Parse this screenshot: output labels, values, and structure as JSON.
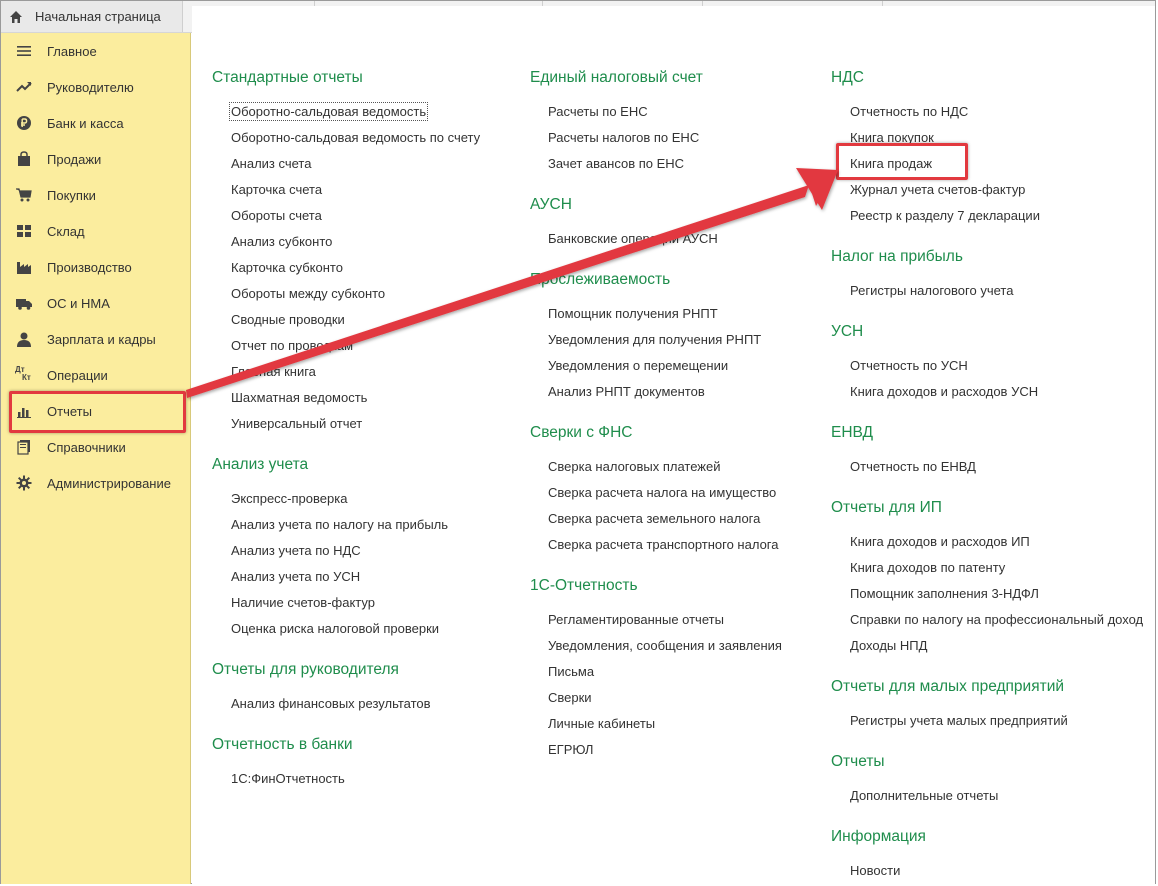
{
  "topbar": {
    "home_label": "Начальная страница"
  },
  "sidebar": {
    "items": [
      {
        "label": "Главное",
        "icon": "menu-icon"
      },
      {
        "label": "Руководителю",
        "icon": "trend-icon"
      },
      {
        "label": "Банк и касса",
        "icon": "ruble-icon"
      },
      {
        "label": "Продажи",
        "icon": "bag-icon"
      },
      {
        "label": "Покупки",
        "icon": "cart-icon"
      },
      {
        "label": "Склад",
        "icon": "grid-icon"
      },
      {
        "label": "Производство",
        "icon": "factory-icon"
      },
      {
        "label": "ОС и НМА",
        "icon": "truck-icon"
      },
      {
        "label": "Зарплата и кадры",
        "icon": "person-icon"
      },
      {
        "label": "Операции",
        "icon": "dt-kt-icon",
        "icon_text_top": "Дт",
        "icon_text_bottom": "Кт"
      },
      {
        "label": "Отчеты",
        "icon": "bar-chart-icon"
      },
      {
        "label": "Справочники",
        "icon": "books-icon"
      },
      {
        "label": "Администрирование",
        "icon": "gear-icon"
      }
    ]
  },
  "columns": {
    "col1": [
      {
        "title": "Стандартные отчеты",
        "links": [
          "Оборотно-сальдовая ведомость",
          "Оборотно-сальдовая ведомость по счету",
          "Анализ счета",
          "Карточка счета",
          "Обороты счета",
          "Анализ субконто",
          "Карточка субконто",
          "Обороты между субконто",
          "Сводные проводки",
          "Отчет по проводкам",
          "Главная книга",
          "Шахматная ведомость",
          "Универсальный отчет"
        ]
      },
      {
        "title": "Анализ учета",
        "links": [
          "Экспресс-проверка",
          "Анализ учета по налогу на прибыль",
          "Анализ учета по НДС",
          "Анализ учета по УСН",
          "Наличие счетов-фактур",
          "Оценка риска налоговой проверки"
        ]
      },
      {
        "title": "Отчеты для руководителя",
        "links": [
          "Анализ финансовых результатов"
        ]
      },
      {
        "title": "Отчетность в банки",
        "links": [
          "1С:ФинОтчетность"
        ]
      }
    ],
    "col2": [
      {
        "title": "Единый налоговый счет",
        "links": [
          "Расчеты по ЕНС",
          "Расчеты налогов по ЕНС",
          "Зачет авансов по ЕНС"
        ]
      },
      {
        "title": "АУСН",
        "links": [
          "Банковские операции АУСН"
        ]
      },
      {
        "title": "Прослеживаемость",
        "links": [
          "Помощник получения РНПТ",
          "Уведомления для получения РНПТ",
          "Уведомления о перемещении",
          "Анализ РНПТ документов"
        ]
      },
      {
        "title": "Сверки с ФНС",
        "links": [
          "Сверка налоговых платежей",
          "Сверка расчета налога на имущество",
          "Сверка расчета земельного налога",
          "Сверка расчета транспортного налога"
        ]
      },
      {
        "title": "1С-Отчетность",
        "links": [
          "Регламентированные отчеты",
          "Уведомления, сообщения и заявления",
          "Письма",
          "Сверки",
          "Личные кабинеты",
          "ЕГРЮЛ"
        ]
      }
    ],
    "col3": [
      {
        "title": "НДС",
        "links": [
          "Отчетность по НДС",
          "Книга покупок",
          "Книга продаж",
          "Журнал учета счетов-фактур",
          "Реестр к разделу 7 декларации"
        ]
      },
      {
        "title": "Налог на прибыль",
        "links": [
          "Регистры налогового учета"
        ]
      },
      {
        "title": "УСН",
        "links": [
          "Отчетность по УСН",
          "Книга доходов и расходов УСН"
        ]
      },
      {
        "title": "ЕНВД",
        "links": [
          "Отчетность по ЕНВД"
        ]
      },
      {
        "title": "Отчеты для ИП",
        "links": [
          "Книга доходов и расходов ИП",
          "Книга доходов по патенту",
          "Помощник заполнения 3-НДФЛ",
          "Справки по налогу на профессиональный доход",
          "Доходы НПД"
        ]
      },
      {
        "title": "Отчеты для малых предприятий",
        "links": [
          "Регистры учета малых предприятий"
        ]
      },
      {
        "title": "Отчеты",
        "links": [
          "Дополнительные отчеты"
        ]
      },
      {
        "title": "Информация",
        "links": [
          "Новости"
        ]
      }
    ]
  },
  "colors": {
    "sidebar_bg": "#fbed9e",
    "section_title": "#1f8d4c",
    "highlight": "#e2393f"
  }
}
